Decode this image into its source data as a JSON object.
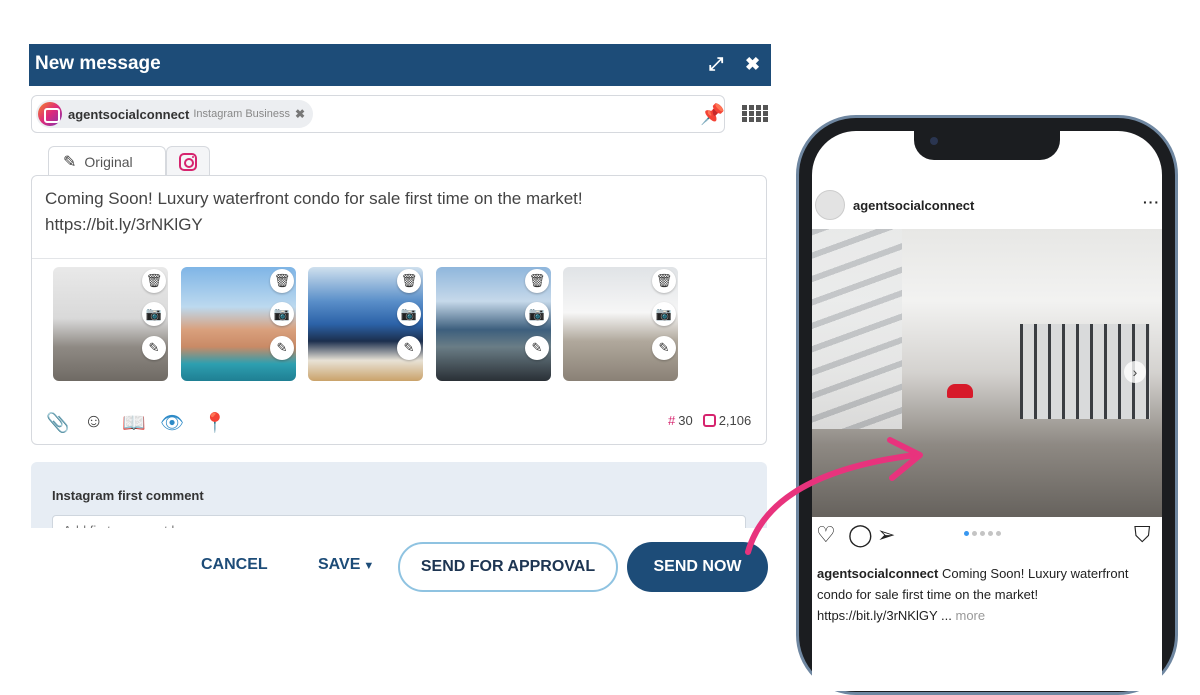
{
  "window": {
    "title": "New message",
    "expand_icon": "expand-icon",
    "close_icon": "close-icon"
  },
  "account": {
    "name": "agentsocialconnect",
    "type": "Instagram Business",
    "remove": "✖"
  },
  "tabs": {
    "original": "Original"
  },
  "message": {
    "text": "Coming Soon! Luxury waterfront condo for sale first time on the market! https://bit.ly/3rNKlGY"
  },
  "thumbnails": [
    {
      "name": "interior-1"
    },
    {
      "name": "island-view"
    },
    {
      "name": "living-room-ocean"
    },
    {
      "name": "bay-view"
    },
    {
      "name": "modern-interior"
    }
  ],
  "thumb_actions": {
    "delete": "🗑",
    "camera": "📷",
    "edit": "✎"
  },
  "toolbar": {
    "icons": [
      "paperclip-icon",
      "smiley-icon",
      "book-icon",
      "eye-icon",
      "location-pin-icon"
    ]
  },
  "stats": {
    "hashtag_symbol": "#",
    "hashtag_count": "30",
    "char_count": "2,106"
  },
  "first_comment": {
    "label": "Instagram first comment",
    "placeholder": "Add first comment here"
  },
  "buttons": {
    "cancel": "CANCEL",
    "save": "SAVE",
    "approval": "SEND FOR APPROVAL",
    "send": "SEND NOW"
  },
  "preview": {
    "username": "agentsocialconnect",
    "menu": "···",
    "caption_text": "Coming Soon! Luxury waterfront condo for sale first time on the market! https://bit.ly/3rNKlGY ...",
    "more": "more",
    "carousel_count": 5,
    "carousel_active": 0
  },
  "colors": {
    "header": "#1d4c78",
    "accent_pink": "#d6246e",
    "arrow": "#e8337d",
    "eye": "#2d8ac7"
  }
}
